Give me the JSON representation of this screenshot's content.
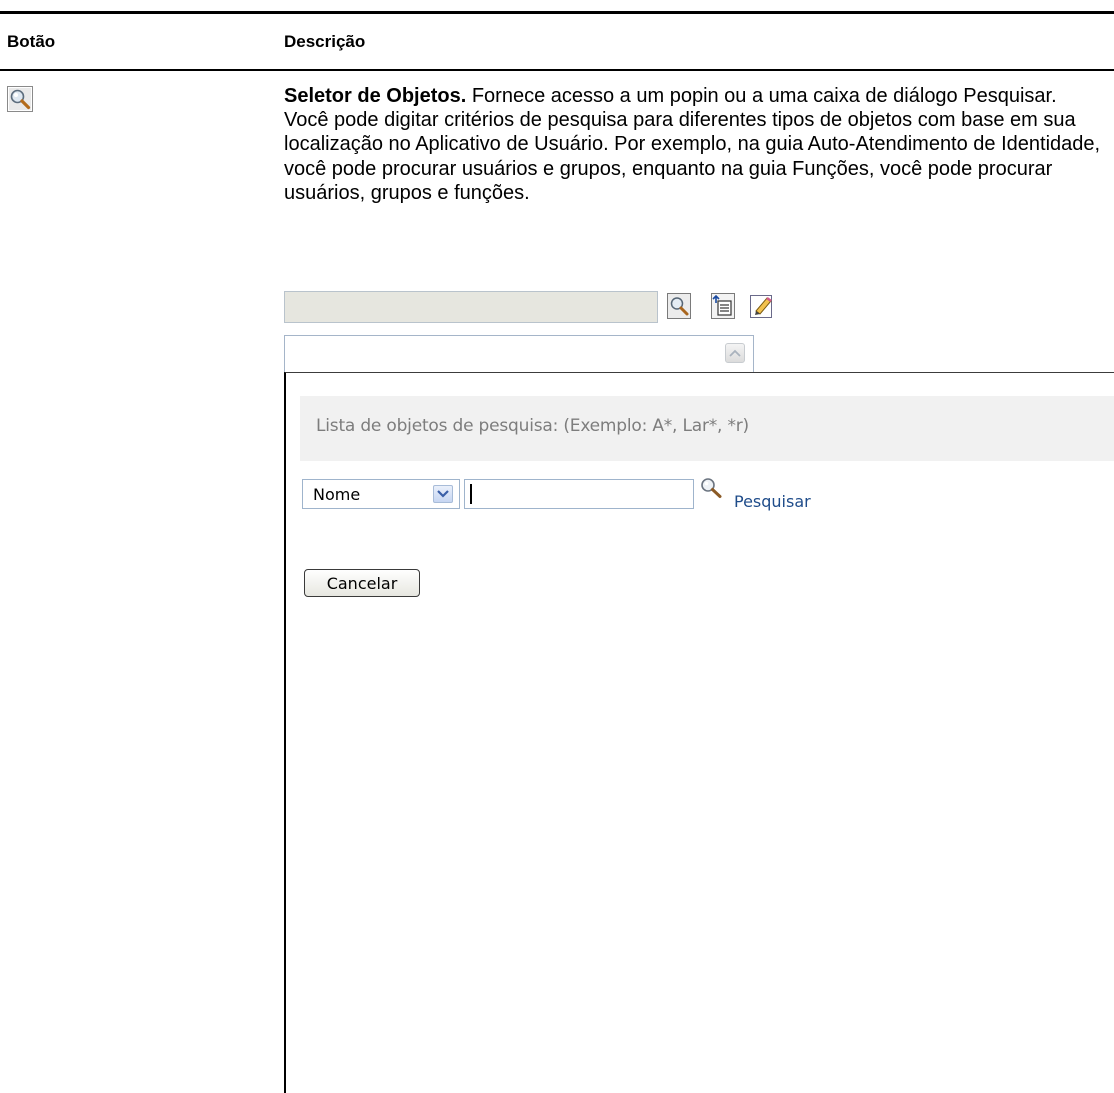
{
  "table": {
    "col_button": "Botão",
    "col_description": "Descrição"
  },
  "row": {
    "icon": "magnifier-search-icon",
    "desc_title": "Seletor de Objetos.",
    "desc_text": " Fornece acesso a um popin ou a uma caixa de diálogo Pesquisar. Você pode digitar critérios de pesquisa para diferentes tipos de objetos com base em sua localização no Aplicativo de Usuário. Por exemplo, na guia Auto-Atendimento de Identidade, você pode procurar usuários e grupos, enquanto na guia Funções, você pode procurar usuários, grupos e funções."
  },
  "inset": {
    "toolbar_icons": [
      "search-icon",
      "history-icon",
      "reset-icon"
    ],
    "popin": {
      "title": "Lista de objetos de pesquisa: (Exemplo: A*, Lar*, *r)",
      "attribute_selected": "Nome",
      "search_value": "",
      "search_link": "Pesquisar",
      "cancel_label": "Cancelar"
    }
  },
  "colors": {
    "rule": "#000000",
    "link": "#1f4c8a",
    "band": "#f1f1f1",
    "muted_text": "#7d7d7d"
  }
}
